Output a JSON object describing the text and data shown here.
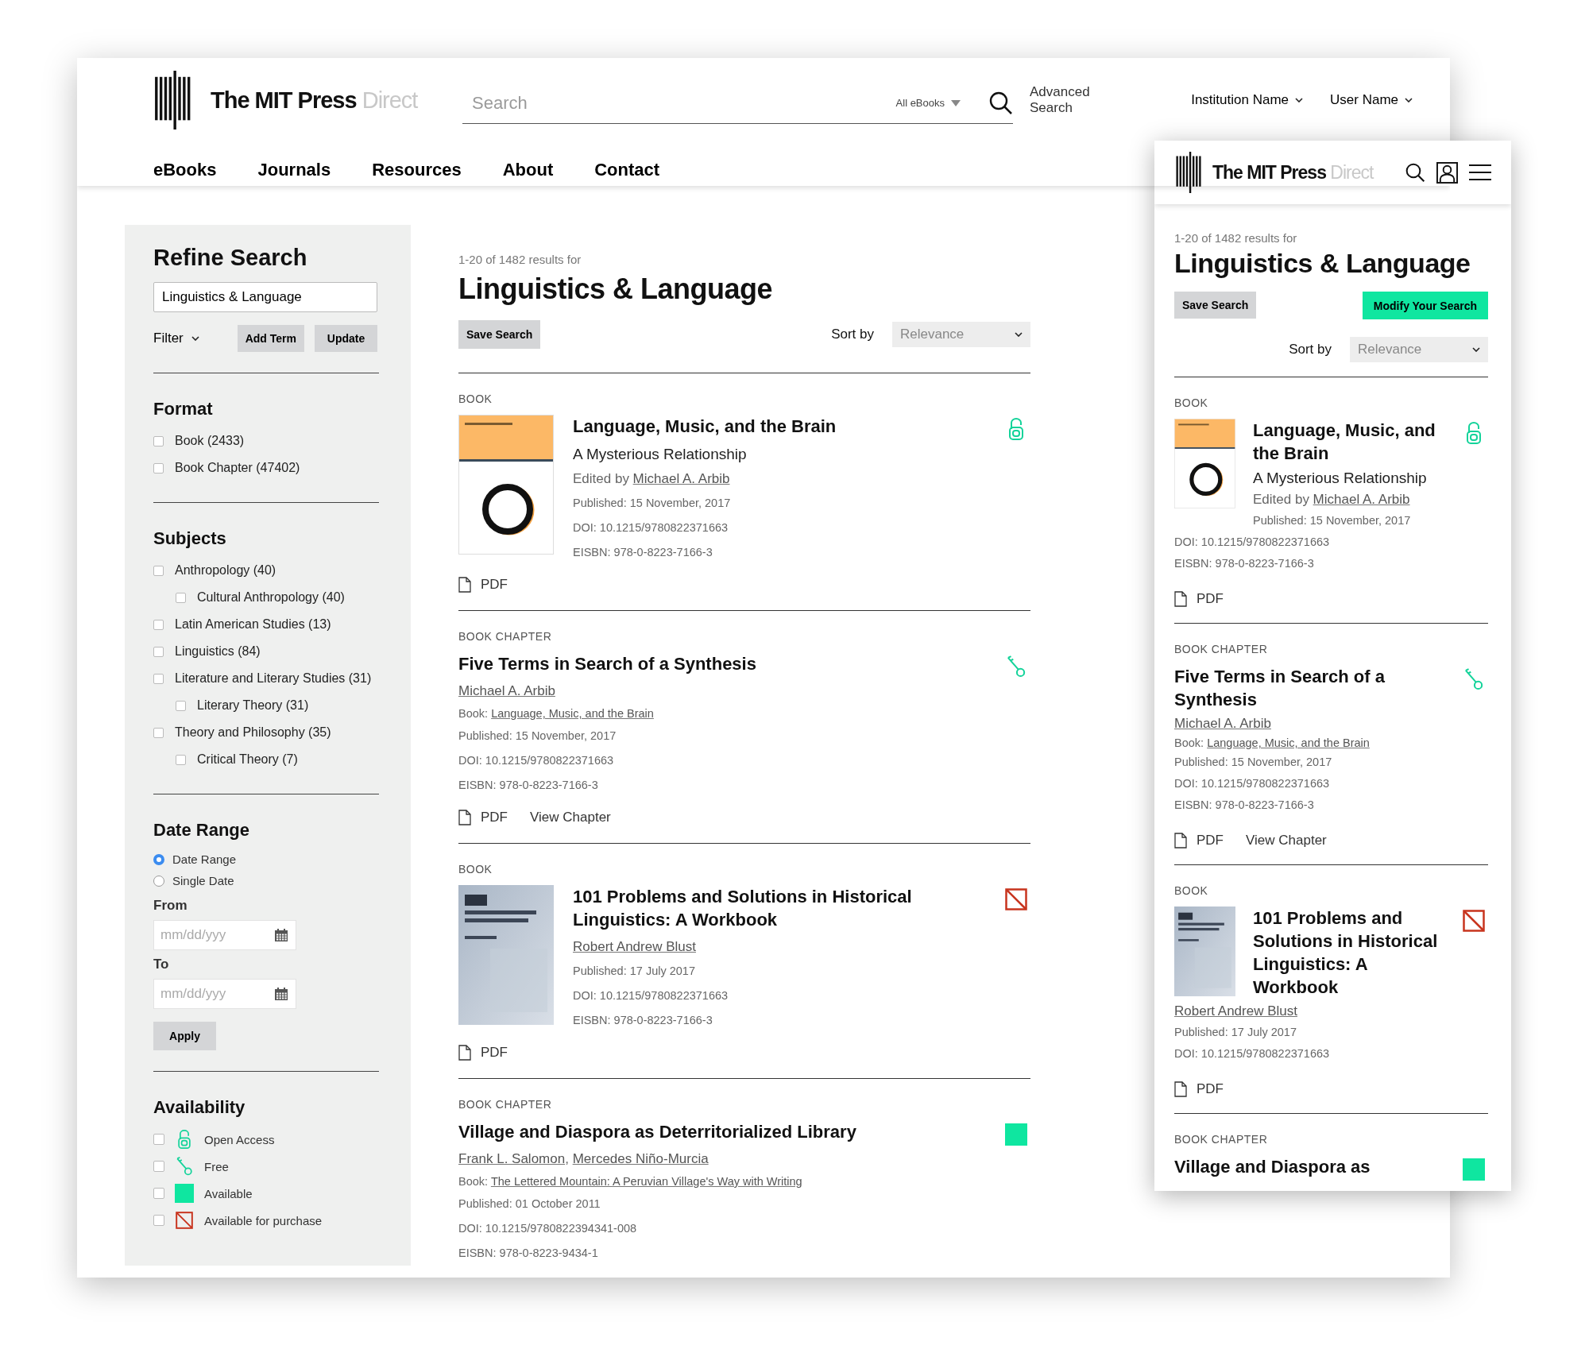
{
  "desktop": {
    "header": {
      "logo": {
        "brand": "The MIT Press",
        "suffix": "Direct"
      },
      "search": {
        "placeholder": "Search",
        "scope": "All eBooks"
      },
      "advanced_search": "Advanced Search",
      "account_menus": [
        "Institution Name",
        "User Name"
      ]
    },
    "nav": [
      "eBooks",
      "Journals",
      "Resources",
      "About",
      "Contact"
    ],
    "sidebar": {
      "title": "Refine Search",
      "term": "Linguistics & Language",
      "filter": "Filter",
      "buttons": [
        "Add Term",
        "Update"
      ],
      "facets": [
        {
          "title": "Format",
          "options": [
            {
              "label": "Book (2433)",
              "checked": false
            },
            {
              "label": "Book Chapter (47402)",
              "checked": false
            }
          ]
        },
        {
          "title": "Subjects",
          "options": [
            {
              "label": "Anthropology (40)",
              "checked": false,
              "children": [
                {
                  "label": "Cultural Anthropology (40)",
                  "checked": false
                }
              ]
            },
            {
              "label": "Latin American Studies (13)",
              "checked": false
            },
            {
              "label": "Linguistics (84)",
              "checked": false
            },
            {
              "label": "Literature and Literary Studies (31)",
              "checked": false,
              "children": [
                {
                  "label": "Literary Theory (31)",
                  "checked": false
                }
              ]
            },
            {
              "label": "Theory and Philosophy (35)",
              "checked": false,
              "children": [
                {
                  "label": "Critical Theory (7)",
                  "checked": false
                }
              ]
            }
          ]
        }
      ],
      "date_range": {
        "title": "Date Range",
        "modes": [
          {
            "label": "Date Range",
            "selected": true
          },
          {
            "label": "Single Date",
            "selected": false
          }
        ],
        "fields": [
          {
            "label": "From",
            "placeholder": "mm/dd/yyy"
          },
          {
            "label": "To",
            "placeholder": "mm/dd/yyy"
          }
        ],
        "apply": "Apply"
      },
      "availability": {
        "title": "Availability",
        "options": [
          {
            "label": "Open Access",
            "kind": "open-access",
            "checked": false
          },
          {
            "label": "Free",
            "kind": "free",
            "checked": false
          },
          {
            "label": "Available",
            "kind": "available",
            "checked": false
          },
          {
            "label": "Available for purchase",
            "kind": "purchase",
            "checked": false
          }
        ]
      }
    },
    "results": {
      "count": "1-20 of 1482 results for",
      "query": "Linguistics & Language",
      "save": "Save Search",
      "sort_label": "Sort by",
      "sort_value": "Relevance",
      "items": [
        {
          "type_label": "BOOK",
          "kind": "book",
          "cover": {
            "kind": "ring"
          },
          "access": {
            "kind": "open-access"
          },
          "title": "Language, Music, and the Brain",
          "subtitle": "A Mysterious Relationship",
          "byline": {
            "prefix": "Edited by",
            "authors": [
              "Michael A. Arbib"
            ]
          },
          "details": [
            "Published: 15 November, 2017",
            "DOI: 10.1215/9780822371663",
            "EISBN: 978-0-8223-7166-3"
          ],
          "actions": [
            "PDF"
          ]
        },
        {
          "type_label": "BOOK CHAPTER",
          "kind": "chapter",
          "access": {
            "kind": "free"
          },
          "title": "Five Terms in Search of a Synthesis",
          "byline": {
            "authors": [
              "Michael A. Arbib"
            ]
          },
          "book": {
            "prefix": "Book:",
            "title": "Language, Music, and the Brain"
          },
          "details": [
            "Published: 15 November, 2017",
            "DOI: 10.1215/9780822371663",
            "EISBN: 978-0-8223-7166-3"
          ],
          "actions": [
            "PDF",
            "View Chapter"
          ]
        },
        {
          "type_label": "BOOK",
          "kind": "book",
          "cover": {
            "kind": "texture"
          },
          "access": {
            "kind": "purchase"
          },
          "title": "101 Problems and Solutions in Historical Linguistics: A Workbook",
          "byline": {
            "authors": [
              "Robert Andrew Blust"
            ]
          },
          "details": [
            "Published: 17 July 2017",
            "DOI: 10.1215/9780822371663",
            "EISBN: 978-0-8223-7166-3"
          ],
          "actions": [
            "PDF"
          ]
        },
        {
          "type_label": "BOOK CHAPTER",
          "kind": "chapter",
          "access": {
            "kind": "available"
          },
          "title": "Village and Diaspora as Deterritorialized Library",
          "byline": {
            "authors": [
              "Frank L. Salomon",
              "Mercedes Niño-Murcia"
            ],
            "separator": ","
          },
          "book": {
            "prefix": "Book:",
            "title": "The Lettered Mountain: A Peruvian Village's Way with Writing"
          },
          "details": [
            "Published: 01 October 2011",
            "DOI: 10.1215/9780822394341-008",
            "EISBN: 978-0-8223-9434-1"
          ]
        }
      ]
    }
  },
  "mobile": {
    "logo": {
      "brand": "The MIT Press",
      "suffix": "Direct"
    },
    "results": {
      "count": "1-20 of 1482 results for",
      "query": "Linguistics & Language",
      "save": "Save Search",
      "modify": "Modify Your Search",
      "sort_label": "Sort by",
      "sort_value": "Relevance",
      "items": [
        {
          "type_label": "BOOK",
          "kind": "book",
          "cover": {
            "kind": "ring"
          },
          "access": {
            "kind": "open-access"
          },
          "title": "Language, Music, and the Brain",
          "subtitle": "A Mysterious Relationship",
          "byline": {
            "prefix": "Edited by",
            "authors": [
              "Michael A. Arbib"
            ]
          },
          "details": [
            "Published: 15 November, 2017",
            "DOI: 10.1215/9780822371663",
            "EISBN: 978-0-8223-7166-3"
          ],
          "actions": [
            "PDF"
          ]
        },
        {
          "type_label": "BOOK CHAPTER",
          "kind": "chapter",
          "access": {
            "kind": "free"
          },
          "title": "Five Terms in Search of a Synthesis",
          "byline": {
            "authors": [
              "Michael A. Arbib"
            ]
          },
          "book": {
            "prefix": "Book:",
            "title": "Language, Music, and the Brain"
          },
          "details": [
            "Published: 15 November, 2017",
            "DOI: 10.1215/9780822371663",
            "EISBN: 978-0-8223-7166-3"
          ],
          "actions": [
            "PDF",
            "View Chapter"
          ]
        },
        {
          "type_label": "BOOK",
          "kind": "book",
          "cover": {
            "kind": "texture"
          },
          "access": {
            "kind": "purchase"
          },
          "title": "101 Problems and Solutions in Historical Linguistics: A Workbook",
          "byline": {
            "authors": [
              "Robert Andrew Blust"
            ]
          },
          "details": [
            "Published: 17 July 2017",
            "DOI: 10.1215/9780822371663"
          ],
          "actions": [
            "PDF"
          ]
        },
        {
          "type_label": "BOOK CHAPTER",
          "kind": "chapter",
          "access": {
            "kind": "available"
          },
          "title": "Village and Diaspora as"
        }
      ]
    }
  }
}
